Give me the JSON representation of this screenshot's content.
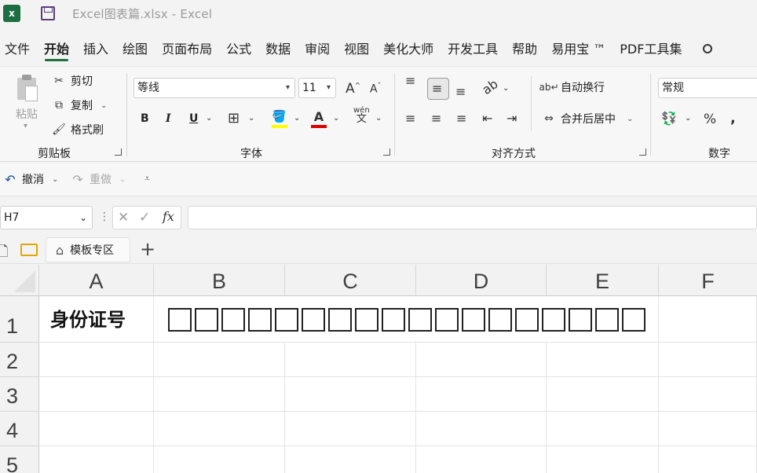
{
  "window": {
    "title": "Excel图表篇.xlsx  -  Excel"
  },
  "menu": [
    {
      "label": "文件"
    },
    {
      "label": "开始"
    },
    {
      "label": "插入"
    },
    {
      "label": "绘图"
    },
    {
      "label": "页面布局"
    },
    {
      "label": "公式"
    },
    {
      "label": "数据"
    },
    {
      "label": "审阅"
    },
    {
      "label": "视图"
    },
    {
      "label": "美化大师"
    },
    {
      "label": "开发工具"
    },
    {
      "label": "帮助"
    },
    {
      "label": "易用宝 ™"
    },
    {
      "label": "PDF工具集"
    }
  ],
  "ribbon": {
    "clipboard": {
      "paste": "粘贴",
      "cut": "剪切",
      "copy": "复制",
      "format_painter": "格式刷",
      "group_label": "剪贴板"
    },
    "font": {
      "font_name": "等线",
      "font_size": "11",
      "bold": "B",
      "italic": "I",
      "underline": "U",
      "phonetic": "wén",
      "phonetic_char": "文",
      "group_label": "字体",
      "grow": "A",
      "shrink": "A"
    },
    "alignment": {
      "wrap_text": "自动换行",
      "merge_center": "合并后居中",
      "group_label": "对齐方式"
    },
    "number": {
      "format": "常规",
      "percent": "%",
      "comma": ",",
      "group_label": "数字"
    }
  },
  "qat": {
    "undo": "撤消",
    "redo": "重做"
  },
  "formula_bar": {
    "name_box": "H7",
    "fx": "fx",
    "formula": ""
  },
  "sheet_tabs": {
    "template_tab": "模板专区",
    "add": "+"
  },
  "grid": {
    "columns": [
      "A",
      "B",
      "C",
      "D",
      "E",
      "F"
    ],
    "rows": [
      "1",
      "2",
      "3",
      "4",
      "5"
    ],
    "cells": {
      "A1": "身份证号"
    },
    "b1_box_count": 18
  }
}
